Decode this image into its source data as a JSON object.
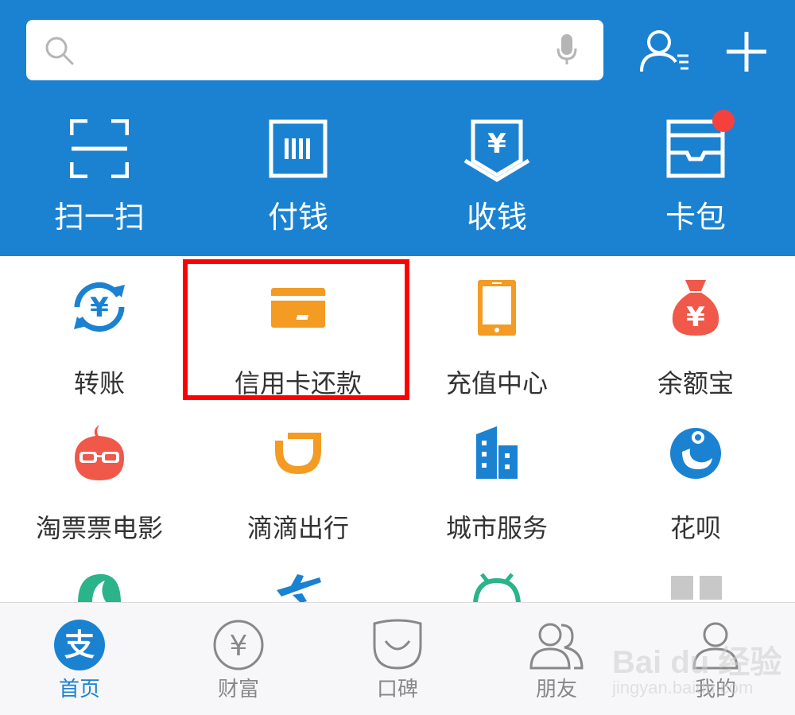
{
  "search": {
    "placeholder": "",
    "value": ""
  },
  "header_actions": {
    "contacts_icon": "contacts-icon",
    "add_icon": "plus-icon"
  },
  "quick_actions": [
    {
      "label": "扫一扫",
      "icon": "scan-icon"
    },
    {
      "label": "付钱",
      "icon": "barcode-pay-icon"
    },
    {
      "label": "收钱",
      "icon": "receive-money-icon"
    },
    {
      "label": "卡包",
      "icon": "card-wallet-icon",
      "badge": true
    }
  ],
  "grid": [
    {
      "label": "转账",
      "icon": "transfer-icon",
      "color": "#1b82d2"
    },
    {
      "label": "信用卡还款",
      "icon": "credit-card-icon",
      "color": "#f39b22",
      "highlighted": true
    },
    {
      "label": "充值中心",
      "icon": "phone-icon",
      "color": "#f39b22"
    },
    {
      "label": "余额宝",
      "icon": "money-bag-icon",
      "color": "#f0584a"
    },
    {
      "label": "淘票票电影",
      "icon": "movie-glasses-icon",
      "color": "#f0584a"
    },
    {
      "label": "滴滴出行",
      "icon": "didi-icon",
      "color": "#f39b22"
    },
    {
      "label": "城市服务",
      "icon": "city-building-icon",
      "color": "#1b82d2"
    },
    {
      "label": "花呗",
      "icon": "huabei-icon",
      "color": "#1b82d2"
    }
  ],
  "partial_row_icons": [
    "leaf-icon",
    "plane-icon",
    "android-icon",
    "more-grid-icon"
  ],
  "tabs": [
    {
      "label": "首页",
      "icon": "alipay-home-icon",
      "active": true
    },
    {
      "label": "财富",
      "icon": "wealth-yen-icon",
      "active": false
    },
    {
      "label": "口碑",
      "icon": "koubei-icon",
      "active": false
    },
    {
      "label": "朋友",
      "icon": "friends-icon",
      "active": false
    },
    {
      "label": "我的",
      "icon": "profile-icon",
      "active": false
    }
  ],
  "colors": {
    "header_blue": "#1b82d2",
    "highlight_red": "#ff0000",
    "badge_red": "#f5413d",
    "orange": "#f39b22"
  },
  "watermark": {
    "line1": "Bai du 经验",
    "line2": "jingyan.baidu.com"
  }
}
